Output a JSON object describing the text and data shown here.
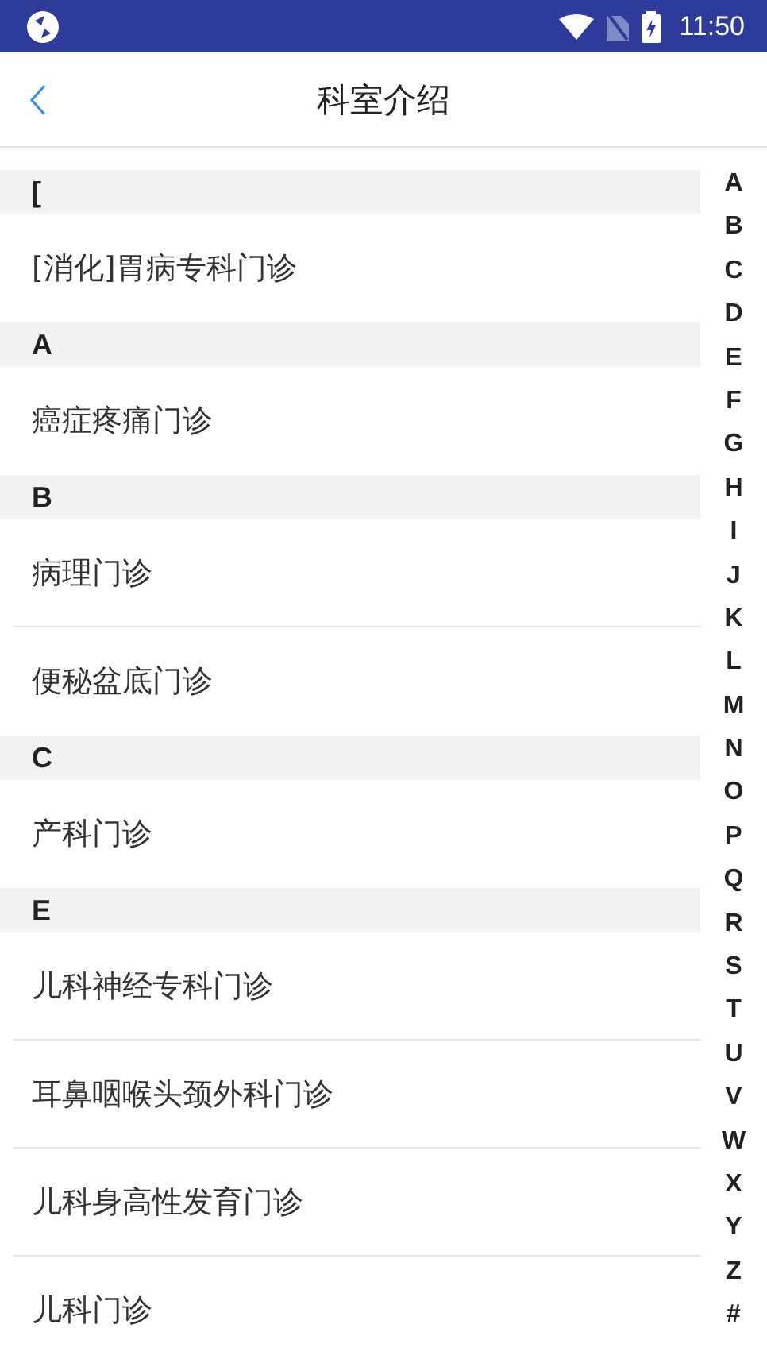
{
  "status_bar": {
    "time": "11:50"
  },
  "header": {
    "title": "科室介绍"
  },
  "sections": [
    {
      "letter": "[",
      "items": [
        "[消化]胃病专科门诊"
      ]
    },
    {
      "letter": "A",
      "items": [
        "癌症疼痛门诊"
      ]
    },
    {
      "letter": "B",
      "items": [
        "病理门诊",
        "便秘盆底门诊"
      ]
    },
    {
      "letter": "C",
      "items": [
        "产科门诊"
      ]
    },
    {
      "letter": "E",
      "items": [
        "儿科神经专科门诊",
        "耳鼻咽喉头颈外科门诊",
        "儿科身高性发育门诊",
        "儿科门诊"
      ]
    }
  ],
  "index": [
    "A",
    "B",
    "C",
    "D",
    "E",
    "F",
    "G",
    "H",
    "I",
    "J",
    "K",
    "L",
    "M",
    "N",
    "O",
    "P",
    "Q",
    "R",
    "S",
    "T",
    "U",
    "V",
    "W",
    "X",
    "Y",
    "Z",
    "#"
  ]
}
